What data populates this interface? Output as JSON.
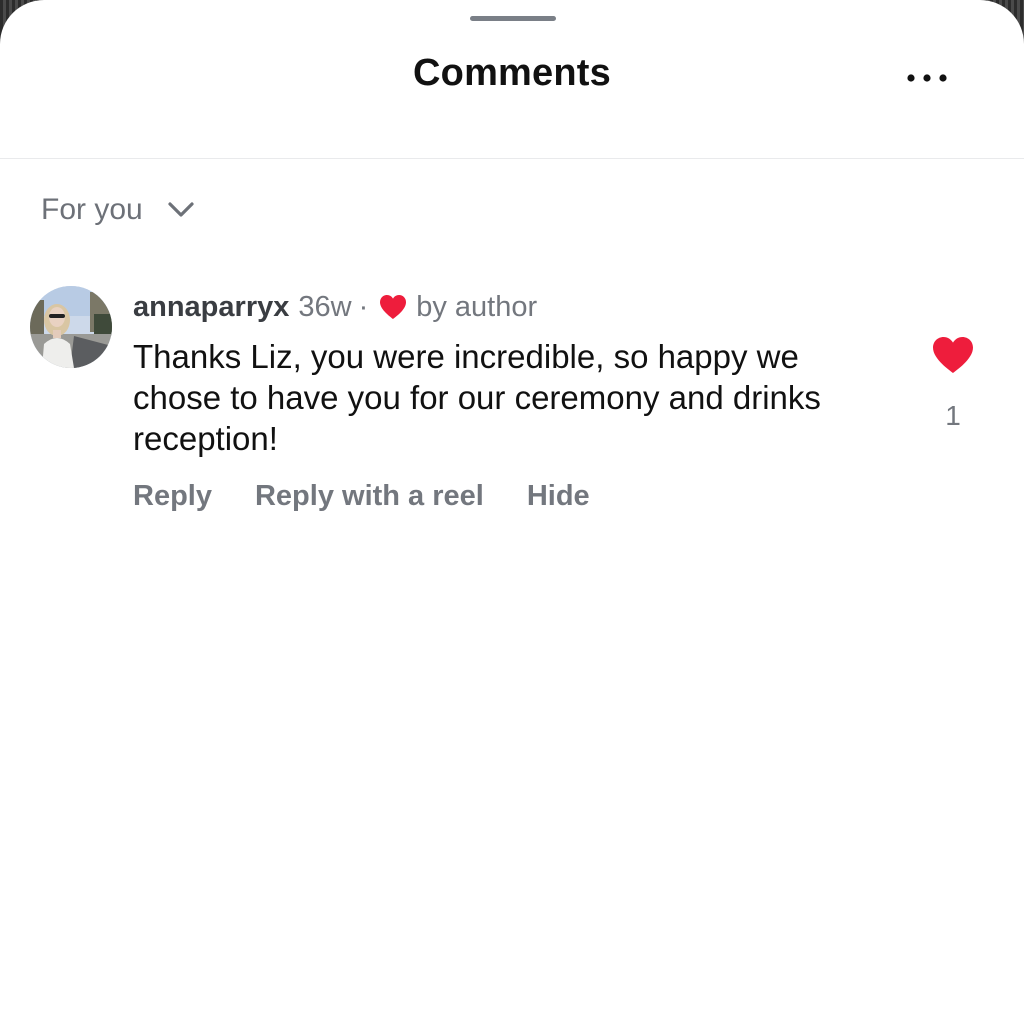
{
  "sheet": {
    "title": "Comments",
    "more_icon": "more-horizontal-icon"
  },
  "filter": {
    "label": "For you",
    "icon": "chevron-down-icon"
  },
  "comment": {
    "username": "annaparryx",
    "time": "36w",
    "separator": "·",
    "author_like_icon": "heart-filled-icon",
    "author_like_label": "by author",
    "text": "Thanks Liz, you were incredible, so happy we chose to have you for our ceremony and drinks reception!",
    "like_count": "1",
    "liked": true,
    "actions": {
      "reply": "Reply",
      "reply_reel": "Reply with a reel",
      "hide": "Hide"
    }
  },
  "colors": {
    "heart": "#ee1d3c",
    "secondary_text": "#73777e",
    "primary_text": "#111111"
  }
}
